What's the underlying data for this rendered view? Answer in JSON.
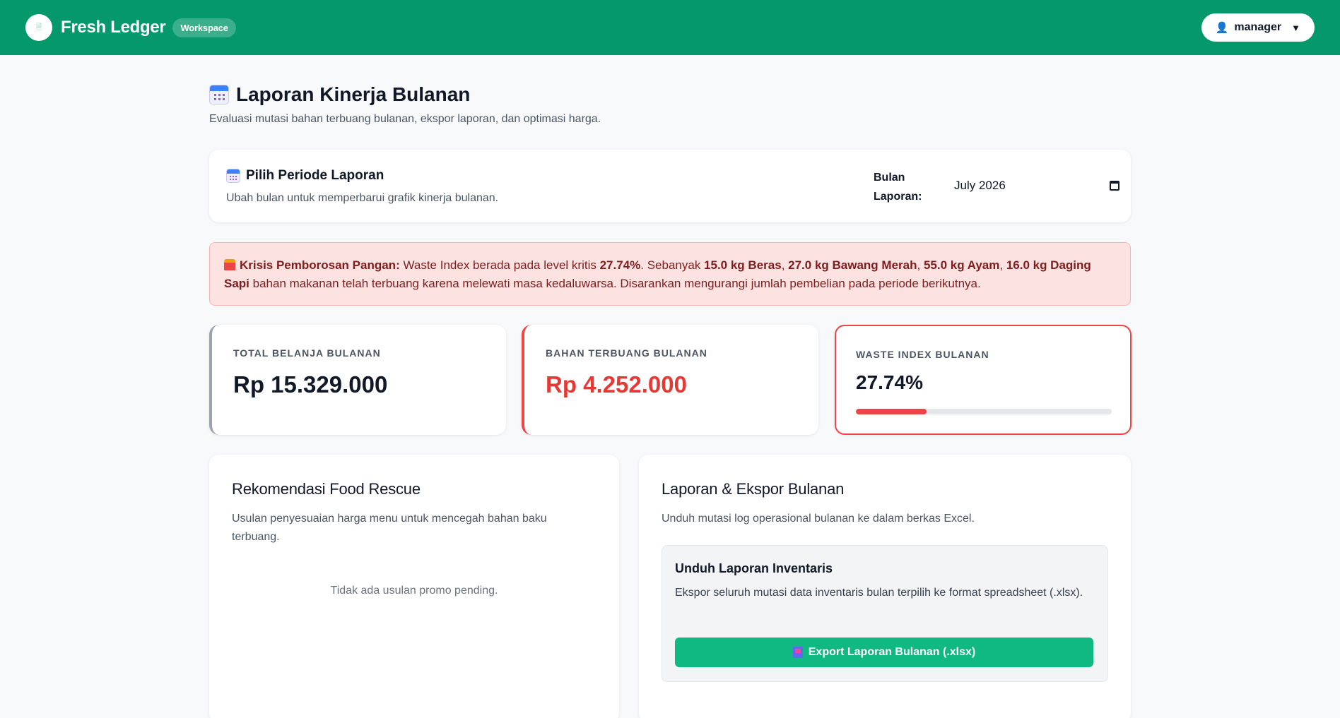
{
  "header": {
    "brand_name": "Fresh Ledger",
    "brand_badge": "Workspace",
    "logo_glyph": "🗎",
    "user_label": "manager",
    "caret": "▼",
    "user_icon": "👤"
  },
  "page": {
    "title": "Laporan Kinerja Bulanan",
    "subtitle": "Evaluasi mutasi bahan terbuang bulanan, ekspor laporan, dan optimasi harga."
  },
  "period": {
    "title": "Pilih Periode Laporan",
    "description": "Ubah bulan untuk memperbarui grafik kinerja bulanan.",
    "month_label": "Bulan Laporan:",
    "month_value": "July  2026"
  },
  "alert": {
    "heading": "Krisis Pemborosan Pangan:",
    "text_1": " Waste Index berada pada level kritis ",
    "index_value": "27.74%",
    "text_2": ". Sebanyak ",
    "item_1": "15.0 kg Beras",
    "sep_1": ", ",
    "item_2": "27.0 kg Bawang Merah",
    "sep_2": ", ",
    "item_3": "55.0 kg Ayam",
    "sep_3": ", ",
    "item_4": "16.0 kg Daging Sapi",
    "text_3": " bahan makanan telah terbuang karena melewati masa kedaluwarsa. Disarankan mengurangi jumlah pembelian pada periode berikutnya."
  },
  "stats": {
    "total_label": "TOTAL BELANJA BULANAN",
    "total_value": "Rp 15.329.000",
    "waste_label": "BAHAN TERBUANG BULANAN",
    "waste_value": "Rp 4.252.000",
    "index_label": "WASTE INDEX BULANAN",
    "index_value": "27.74%",
    "index_fraction": 0.2774
  },
  "rescue": {
    "title": "Rekomendasi Food Rescue",
    "description": "Usulan penyesuaian harga menu untuk mencegah bahan baku terbuang.",
    "empty_text": "Tidak ada usulan promo pending."
  },
  "export": {
    "title": "Laporan & Ekspor Bulanan",
    "description": "Unduh mutasi log operasional bulanan ke dalam berkas Excel.",
    "box_title": "Unduh Laporan Inventaris",
    "box_description": "Ekspor seluruh mutasi data inventaris bulan terpilih ke format spreadsheet (.xlsx).",
    "button_label": "Export Laporan Bulanan (.xlsx)"
  },
  "colors": {
    "header_bg": "#05986a",
    "danger": "#ef4444",
    "button_green": "#10b981"
  }
}
